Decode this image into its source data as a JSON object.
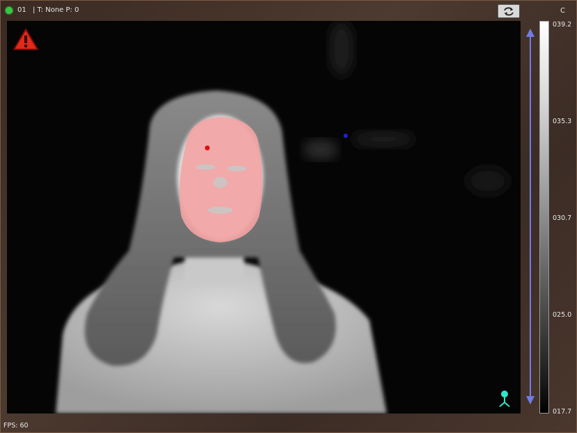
{
  "topbar": {
    "camera_id": "01",
    "camera_info": "| T: None  P: 0",
    "unit": "C",
    "status_color": "#2ecc40",
    "switch_icon": "camera-switch-icon"
  },
  "thermal_view": {
    "warning_icon": "warning-icon",
    "hot_marker_color": "#e01010",
    "cold_marker_color": "#2020e0",
    "overlay_color": "#f4a3a3",
    "person_icon": "person-pin-icon"
  },
  "color_scale": {
    "labels": [
      "039.2",
      "035.3",
      "030.7",
      "025.0",
      "017.7"
    ]
  },
  "range_slider": {
    "color": "#6f7de6"
  },
  "footer": {
    "fps": "FPS: 60"
  }
}
